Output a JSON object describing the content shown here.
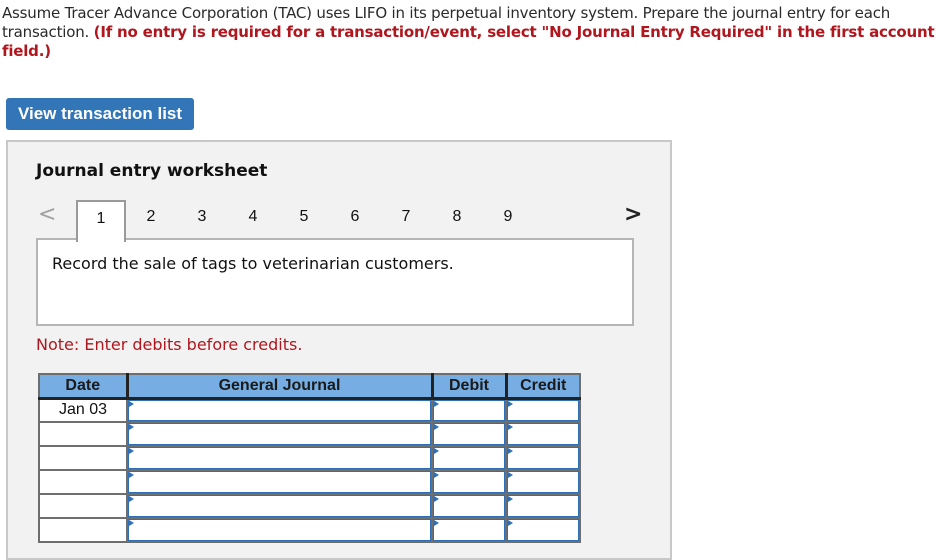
{
  "instructions": {
    "text": "Assume Tracer Advance Corporation (TAC) uses LIFO in its perpetual inventory system. Prepare the journal entry for each transaction. ",
    "emphasis": "(If no entry is required for a transaction/event, select \"No Journal Entry Required\" in the first account field.)"
  },
  "view_button": "View transaction list",
  "worksheet": {
    "title": "Journal entry worksheet",
    "prev_icon": "chevron-left-icon",
    "next_icon": "chevron-right-icon",
    "tabs": [
      "1",
      "2",
      "3",
      "4",
      "5",
      "6",
      "7",
      "8",
      "9"
    ],
    "active_tab": "1",
    "description": "Record the sale of tags to veterinarian customers.",
    "note": "Note: Enter debits before credits."
  },
  "journal": {
    "headers": {
      "date": "Date",
      "general_journal": "General Journal",
      "debit": "Debit",
      "credit": "Credit"
    },
    "rows": [
      {
        "date": "Jan 03",
        "account": "",
        "debit": "",
        "credit": ""
      },
      {
        "date": "",
        "account": "",
        "debit": "",
        "credit": ""
      },
      {
        "date": "",
        "account": "",
        "debit": "",
        "credit": ""
      },
      {
        "date": "",
        "account": "",
        "debit": "",
        "credit": ""
      },
      {
        "date": "",
        "account": "",
        "debit": "",
        "credit": ""
      },
      {
        "date": "",
        "account": "",
        "debit": "",
        "credit": ""
      }
    ]
  },
  "colors": {
    "accent_blue": "#3376b8",
    "header_blue": "#76aee3",
    "note_red": "#b0161e"
  }
}
